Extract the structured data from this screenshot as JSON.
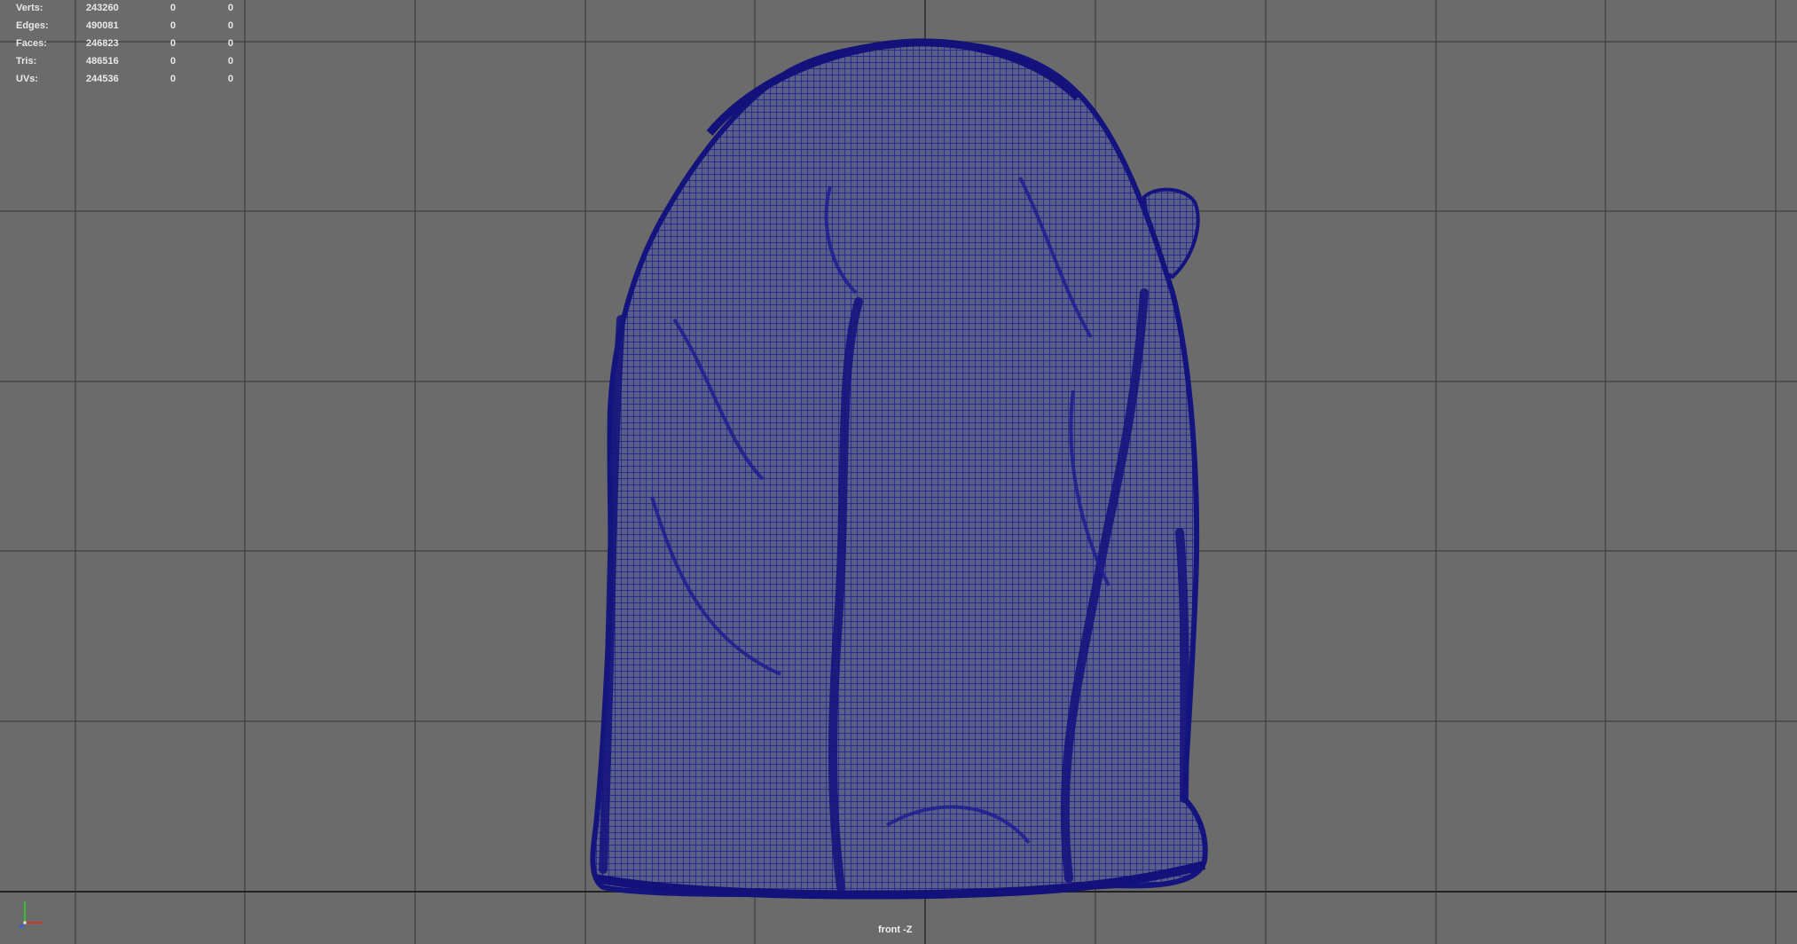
{
  "heads_up_display": {
    "stats": [
      {
        "label": "Verts:",
        "total": "243260",
        "selected": "0",
        "selected_b": "0"
      },
      {
        "label": "Edges:",
        "total": "490081",
        "selected": "0",
        "selected_b": "0"
      },
      {
        "label": "Faces:",
        "total": "246823",
        "selected": "0",
        "selected_b": "0"
      },
      {
        "label": "Tris:",
        "total": "486516",
        "selected": "0",
        "selected_b": "0"
      },
      {
        "label": "UVs:",
        "total": "244536",
        "selected": "0",
        "selected_b": "0"
      }
    ]
  },
  "viewport": {
    "camera_label": "front -Z",
    "background_color": "#6b6b6b",
    "grid_color": "#3d3d3d",
    "wireframe_color": "#1a1a8c"
  },
  "axis_gizmo": {
    "x_color": "#d03030",
    "y_color": "#30c030",
    "z_color": "#3060e0"
  }
}
